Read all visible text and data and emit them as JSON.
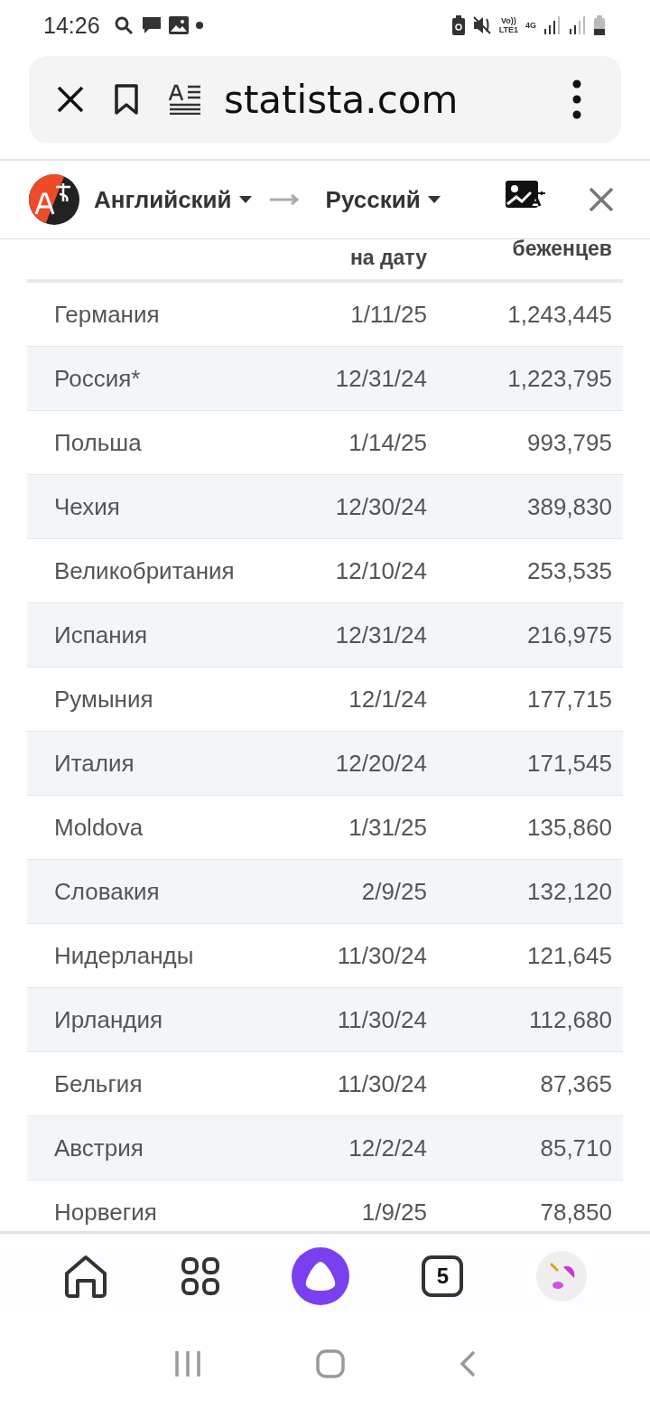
{
  "status_bar": {
    "time": "14:26",
    "volte": "Vo))",
    "lte": "LTE1",
    "network": "4G"
  },
  "address_bar": {
    "url": "statista.com"
  },
  "translate_bar": {
    "source": "Английский",
    "target": "Русский"
  },
  "table": {
    "columns": [
      "",
      "на дату",
      "беженцев"
    ],
    "rows": [
      {
        "country": "Германия",
        "date": "1/11/25",
        "refugees": "1,243,445"
      },
      {
        "country": "Россия*",
        "date": "12/31/24",
        "refugees": "1,223,795"
      },
      {
        "country": "Польша",
        "date": "1/14/25",
        "refugees": "993,795"
      },
      {
        "country": "Чехия",
        "date": "12/30/24",
        "refugees": "389,830"
      },
      {
        "country": "Великобритания",
        "date": "12/10/24",
        "refugees": "253,535"
      },
      {
        "country": "Испания",
        "date": "12/31/24",
        "refugees": "216,975"
      },
      {
        "country": "Румыния",
        "date": "12/1/24",
        "refugees": "177,715"
      },
      {
        "country": "Италия",
        "date": "12/20/24",
        "refugees": "171,545"
      },
      {
        "country": "Moldova",
        "date": "1/31/25",
        "refugees": "135,860"
      },
      {
        "country": "Словакия",
        "date": "2/9/25",
        "refugees": "132,120"
      },
      {
        "country": "Нидерланды",
        "date": "11/30/24",
        "refugees": "121,645"
      },
      {
        "country": "Ирландия",
        "date": "11/30/24",
        "refugees": "112,680"
      },
      {
        "country": "Бельгия",
        "date": "11/30/24",
        "refugees": "87,365"
      },
      {
        "country": "Австрия",
        "date": "12/2/24",
        "refugees": "85,710"
      },
      {
        "country": "Норвегия",
        "date": "1/9/25",
        "refugees": "78,850"
      }
    ]
  },
  "bottom_nav": {
    "tab_count": "5"
  }
}
